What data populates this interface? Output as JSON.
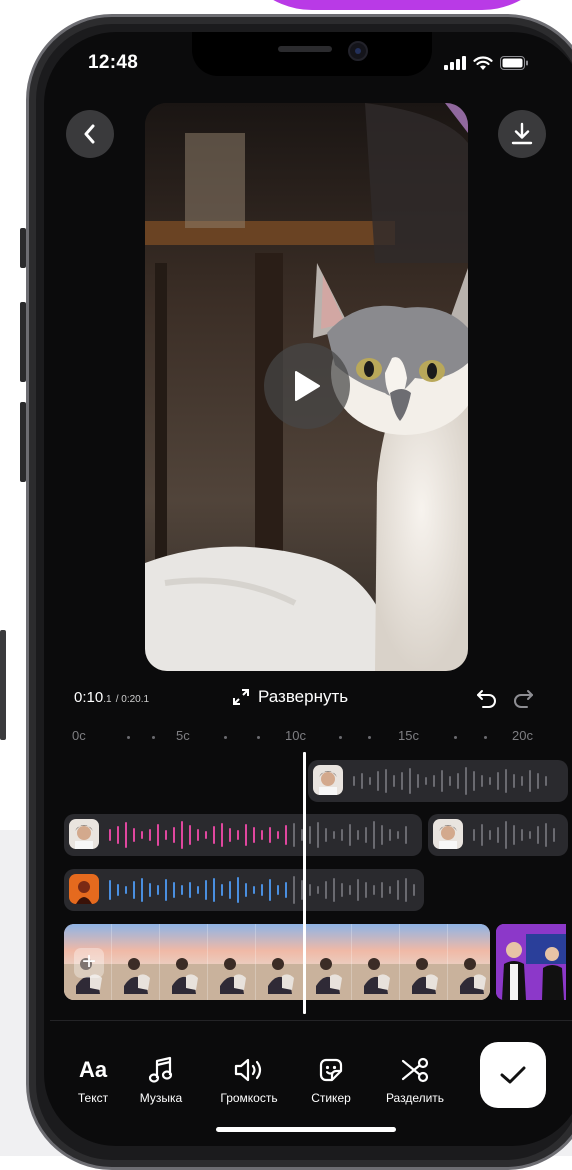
{
  "status_bar": {
    "time": "12:48"
  },
  "player": {
    "current_time": "0:10",
    "current_frac": ".1",
    "total_time": "/ 0:20.1",
    "expand_label": "Развернуть"
  },
  "ruler": {
    "labels": [
      "0с",
      "5с",
      "10с",
      "15с",
      "20с"
    ]
  },
  "toolbar": {
    "items": [
      {
        "label": "Текст",
        "icon": "text-aa-icon",
        "glyph": "Aa"
      },
      {
        "label": "Музыка",
        "icon": "music-note-icon"
      },
      {
        "label": "Громкость",
        "icon": "volume-icon"
      },
      {
        "label": "Стикер",
        "icon": "sticker-icon"
      },
      {
        "label": "Разделить",
        "icon": "scissors-icon"
      }
    ]
  },
  "colors": {
    "accent_pink": "#e0479f",
    "accent_blue": "#4a8fe0",
    "track_bg": "#2a2a2e",
    "screen_bg": "#0b0b0c"
  }
}
